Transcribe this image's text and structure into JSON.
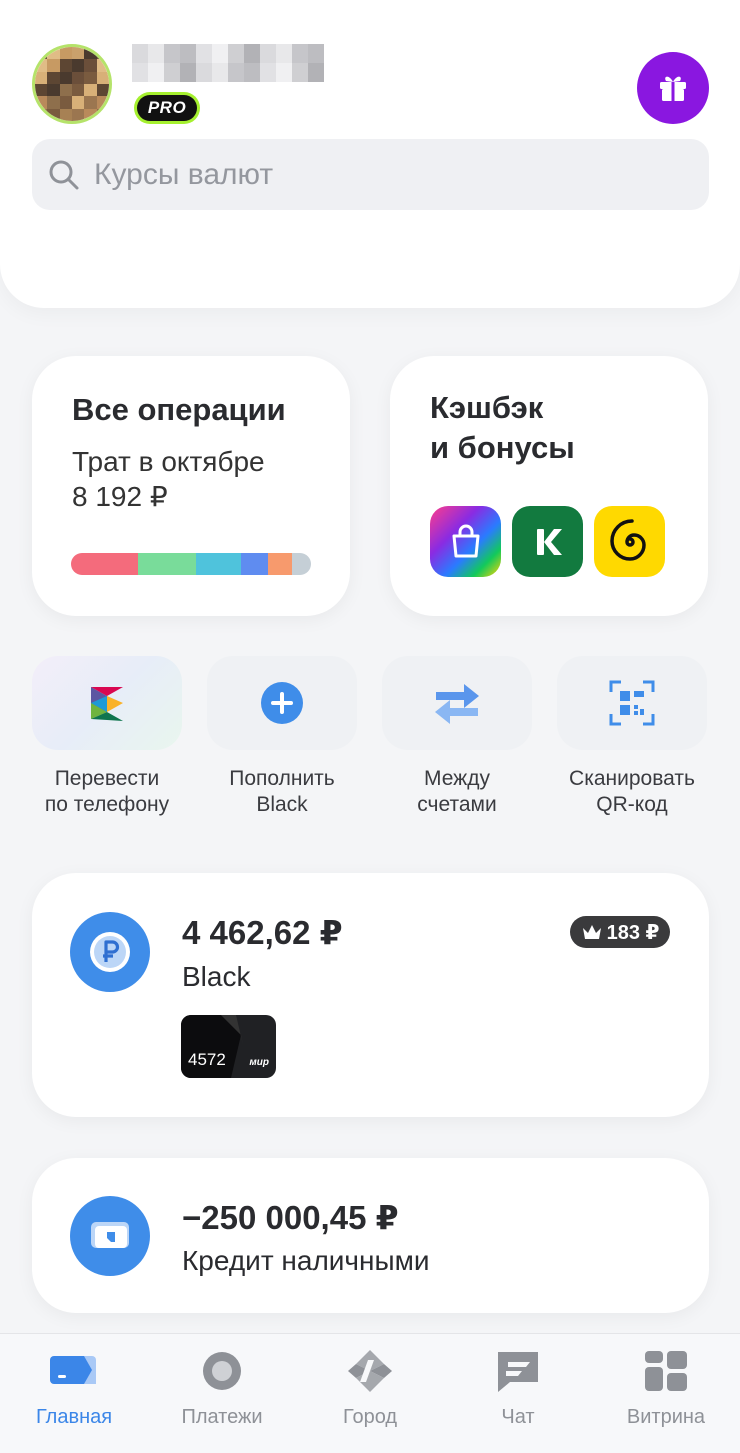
{
  "header": {
    "pro_badge": "PRO"
  },
  "search": {
    "placeholder": "Курсы валют"
  },
  "operations": {
    "title": "Все операции",
    "subtitle": "Трат в октябре",
    "amount": "8 192 ₽",
    "spend_segments": [
      {
        "color": "#f46b7c",
        "share": 0.28
      },
      {
        "color": "#79dc9a",
        "share": 0.24
      },
      {
        "color": "#4fc3dc",
        "share": 0.19
      },
      {
        "color": "#5f8cf0",
        "share": 0.11
      },
      {
        "color": "#f79a6d",
        "share": 0.1
      },
      {
        "color": "#c5cfd6",
        "share": 0.08
      }
    ]
  },
  "cashback": {
    "title_line1": "Кэшбэк",
    "title_line2": "и бонусы",
    "partners": [
      "shopping-bag-icon",
      "k-logo-icon",
      "spiral-logo-icon"
    ]
  },
  "quick_actions": [
    {
      "line1": "Перевести",
      "line2": "по телефону",
      "icon": "sbp-icon"
    },
    {
      "line1": "Пополнить",
      "line2": "Black",
      "icon": "plus-icon"
    },
    {
      "line1": "Между",
      "line2": "счетами",
      "icon": "transfer-arrows-icon"
    },
    {
      "line1": "Сканировать",
      "line2": "QR-код",
      "icon": "qr-icon"
    }
  ],
  "account": {
    "amount": "4 462,62 ₽",
    "name": "Black",
    "bonus": "183 ₽",
    "card_number": "4572",
    "card_system": "мир"
  },
  "credit": {
    "amount": "−250 000,45 ₽",
    "name": "Кредит наличными"
  },
  "tabs": [
    {
      "label": "Главная",
      "active": true
    },
    {
      "label": "Платежи",
      "active": false
    },
    {
      "label": "Город",
      "active": false
    },
    {
      "label": "Чат",
      "active": false
    },
    {
      "label": "Витрина",
      "active": false
    }
  ],
  "colors": {
    "accent": "#3b86e8",
    "gift": "#8a17e0",
    "pro_border": "#a5f02f"
  }
}
